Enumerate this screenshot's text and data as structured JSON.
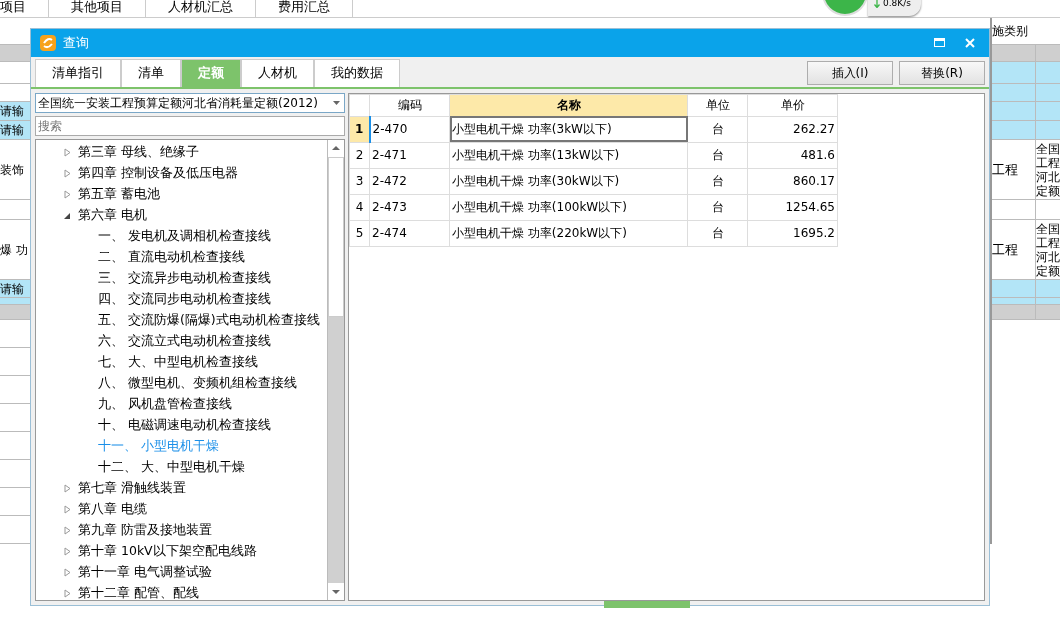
{
  "background": {
    "tabs": [
      "项目",
      "其他项目",
      "人材机汇总",
      "费用汇总"
    ],
    "header": "施类别",
    "left_cells": [
      "请输",
      "请输",
      "装饰",
      "爆 功",
      "请输"
    ],
    "right_cells": [
      {
        "kind": "work",
        "text": "工程",
        "note": "全国工程河北定额"
      },
      {
        "kind": "work",
        "text": "工程",
        "note": "全国工程河北定额"
      }
    ]
  },
  "speed": "0.8K/s",
  "dialog": {
    "title": "查询",
    "tabs": [
      {
        "label": "清单指引",
        "selected": false
      },
      {
        "label": "清单",
        "selected": false
      },
      {
        "label": "定额",
        "selected": true
      },
      {
        "label": "人材机",
        "selected": false
      },
      {
        "label": "我的数据",
        "selected": false
      }
    ],
    "buttons": [
      "插入(I)",
      "替换(R)"
    ],
    "library": "全国统一安装工程预算定额河北省消耗量定额(2012)",
    "search": {
      "placeholder": "搜索"
    },
    "tree": [
      {
        "label": "第三章 母线、绝缘子",
        "expanded": false
      },
      {
        "label": "第四章 控制设备及低压电器",
        "expanded": false
      },
      {
        "label": "第五章 蓄电池",
        "expanded": false
      },
      {
        "label": "第六章 电机",
        "expanded": true,
        "children": [
          {
            "label": "一、 发电机及调相机检查接线",
            "selected": false
          },
          {
            "label": "二、 直流电动机检查接线",
            "selected": false
          },
          {
            "label": "三、 交流异步电动机检查接线",
            "selected": false
          },
          {
            "label": "四、 交流同步电动机检查接线",
            "selected": false
          },
          {
            "label": "五、 交流防爆(隔爆)式电动机检查接线",
            "selected": false
          },
          {
            "label": "六、 交流立式电动机检查接线",
            "selected": false
          },
          {
            "label": "七、 大、中型电机检查接线",
            "selected": false
          },
          {
            "label": "八、 微型电机、变频机组检查接线",
            "selected": false
          },
          {
            "label": "九、 风机盘管检查接线",
            "selected": false
          },
          {
            "label": "十、 电磁调速电动机检查接线",
            "selected": false
          },
          {
            "label": "十一、 小型电机干燥",
            "selected": true
          },
          {
            "label": "十二、 大、中型电机干燥",
            "selected": false
          }
        ]
      },
      {
        "label": "第七章 滑触线装置",
        "expanded": false
      },
      {
        "label": "第八章 电缆",
        "expanded": false
      },
      {
        "label": "第九章 防雷及接地装置",
        "expanded": false
      },
      {
        "label": "第十章 10kV以下架空配电线路",
        "expanded": false
      },
      {
        "label": "第十一章 电气调整试验",
        "expanded": false
      },
      {
        "label": "第十二章 配管、配线",
        "expanded": false
      }
    ],
    "table": {
      "columns": [
        {
          "label": "编码",
          "selected": false
        },
        {
          "label": "名称",
          "selected": true
        },
        {
          "label": "单位",
          "selected": false
        },
        {
          "label": "单价",
          "selected": false
        }
      ],
      "rows": [
        {
          "index": "1",
          "code": "2-470",
          "name": "小型电机干燥 功率(3kW以下)",
          "unit": "台",
          "price": "262.27",
          "selected": true
        },
        {
          "index": "2",
          "code": "2-471",
          "name": "小型电机干燥 功率(13kW以下)",
          "unit": "台",
          "price": "481.6",
          "selected": false
        },
        {
          "index": "3",
          "code": "2-472",
          "name": "小型电机干燥 功率(30kW以下)",
          "unit": "台",
          "price": "860.17",
          "selected": false
        },
        {
          "index": "4",
          "code": "2-473",
          "name": "小型电机干燥 功率(100kW以下)",
          "unit": "台",
          "price": "1254.65",
          "selected": false
        },
        {
          "index": "5",
          "code": "2-474",
          "name": "小型电机干燥 功率(220kW以下)",
          "unit": "台",
          "price": "1695.2",
          "selected": false
        }
      ]
    }
  }
}
